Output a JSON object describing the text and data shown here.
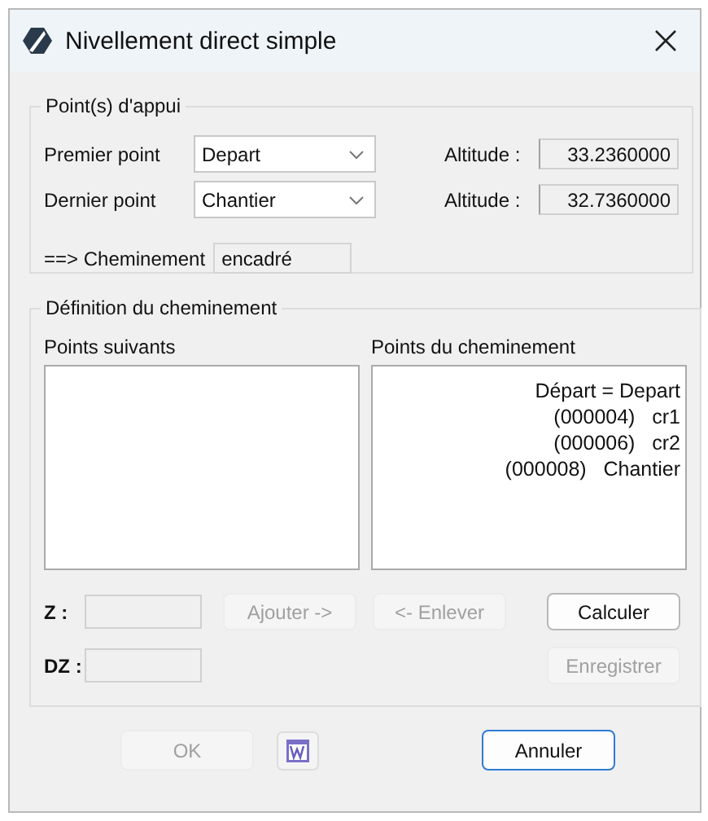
{
  "window": {
    "title": "Nivellement direct simple"
  },
  "support_points": {
    "title": "Point(s) d'appui",
    "rows": [
      {
        "label": "Premier point",
        "value": "Depart",
        "altitude_label": "Altitude :",
        "altitude": "33.2360000"
      },
      {
        "label": "Dernier point",
        "value": "Chantier",
        "altitude_label": "Altitude :",
        "altitude": "32.7360000"
      }
    ],
    "route_label": "==> Cheminement",
    "route_value": "encadré"
  },
  "route_definition": {
    "title": "Définition du cheminement",
    "next_points_title": "Points suivants",
    "route_points_title": "Points du cheminement",
    "route_points": [
      "Départ = Depart",
      "(000004)   cr1",
      "(000006)   cr2",
      "(000008)   Chantier"
    ],
    "fields": [
      {
        "label": "Z :",
        "disabled": true
      },
      {
        "label": "DZ :",
        "disabled": true
      }
    ],
    "buttons": [
      {
        "label": "Ajouter ->",
        "disabled": true
      },
      {
        "label": "<- Enlever",
        "disabled": true
      },
      {
        "label": "Calculer",
        "disabled": false
      },
      {
        "label": "Enregistrer",
        "disabled": true
      }
    ]
  },
  "footer": [
    {
      "kind": "button",
      "label": "OK",
      "disabled": true,
      "default": false
    },
    {
      "kind": "icon"
    },
    {
      "kind": "button",
      "label": "Annuler",
      "disabled": false,
      "default": true
    }
  ]
}
